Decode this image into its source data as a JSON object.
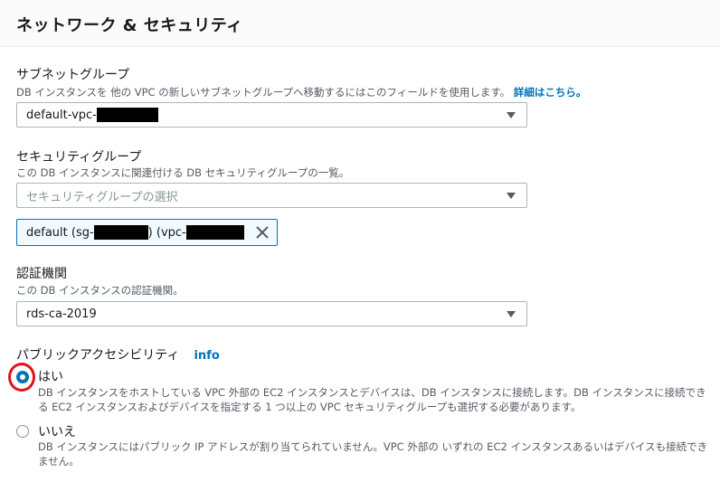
{
  "section": {
    "title": "ネットワーク & セキュリティ"
  },
  "subnet_group": {
    "label": "サブネットグループ",
    "description": "DB インスタンスを 他の VPC の新しいサブネットグループへ移動するにはこのフィールドを使用します。",
    "link_text": "詳細はこちら。",
    "value": "default-vpc-"
  },
  "security_group": {
    "label": "セキュリティグループ",
    "description": "この DB インスタンスに関連付ける DB セキュリティグループの一覧。",
    "placeholder": "セキュリティグループの選択",
    "token_prefix": "default (sg-",
    "token_middle": ") (vpc-"
  },
  "certificate_authority": {
    "label": "認証機関",
    "description": "この DB インスタンスの認証機関。",
    "value": "rds-ca-2019"
  },
  "public_access": {
    "label": "パブリックアクセシビリティ",
    "info_link": "info",
    "options": [
      {
        "label": "はい",
        "description": "DB インスタンスをホストしている VPC 外部の EC2 インスタンスとデバイスは、DB インスタンスに接続します。DB インスタンスに接続できる EC2 インスタンスおよびデバイスを指定する 1 つ以上の VPC セキュリティグループも選択する必要があります。",
        "selected": true
      },
      {
        "label": "いいえ",
        "description": "DB インスタンスにはパブリック IP アドレスが割り当てられていません。VPC 外部の いずれの EC2 インスタンスあるいはデバイスも接続できません。",
        "selected": false
      }
    ]
  },
  "colors": {
    "accent": "#0073bb",
    "highlight_ring": "#e0121b"
  },
  "icons": {
    "dropdown": "caret-down-icon",
    "remove": "close-icon"
  }
}
